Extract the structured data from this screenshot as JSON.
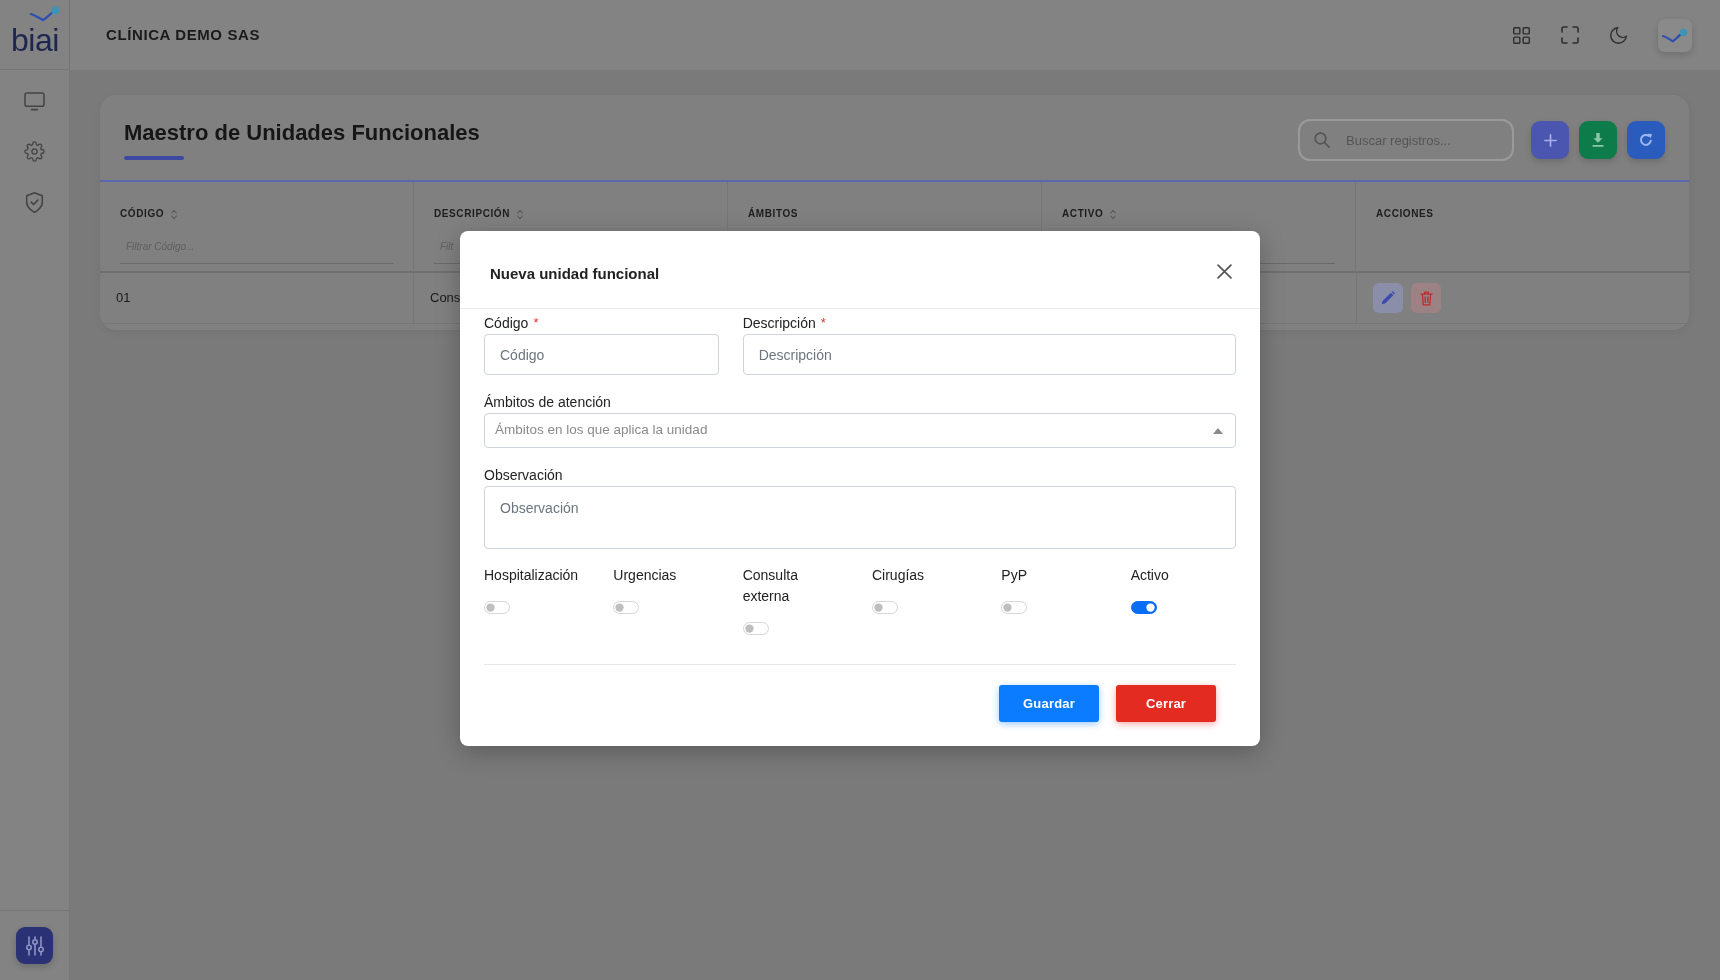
{
  "sidebar": {
    "logo": "biai"
  },
  "topbar": {
    "title": "CLÍNICA DEMO SAS"
  },
  "page": {
    "title": "Maestro de Unidades Funcionales",
    "search": {
      "placeholder": "Buscar registros..."
    }
  },
  "table": {
    "columns": [
      {
        "label": "CÓDIGO",
        "sortable": true,
        "filter": true,
        "filter_placeholder": "Filtrar Código..."
      },
      {
        "label": "DESCRIPCIÓN",
        "sortable": true,
        "filter": true,
        "filter_placeholder": "Filt"
      },
      {
        "label": "ÁMBITOS",
        "sortable": false,
        "filter": false
      },
      {
        "label": "ACTIVO",
        "sortable": true,
        "filter": true
      },
      {
        "label": "ACCIONES",
        "sortable": false,
        "filter": false
      }
    ],
    "rows": [
      {
        "cells": [
          "01",
          "Cons"
        ]
      }
    ]
  },
  "modal": {
    "title": "Nueva unidad funcional",
    "fields": [
      {
        "kind": "input",
        "label": "Código",
        "required_mark": "*",
        "placeholder": "Código"
      },
      {
        "kind": "input",
        "label": "Descripción",
        "required_mark": "*",
        "placeholder": "Descripción"
      },
      {
        "kind": "select",
        "label": "Ámbitos de atención",
        "placeholder": "Ámbitos en los que aplica la unidad"
      },
      {
        "kind": "textarea",
        "label": "Observación",
        "placeholder": "Observación"
      }
    ],
    "toggles": [
      {
        "label": "Hospitalización",
        "on": false
      },
      {
        "label": "Urgencias",
        "on": false
      },
      {
        "label": "Consulta externa",
        "on": false
      },
      {
        "label": "Cirugías",
        "on": false
      },
      {
        "label": "PyP",
        "on": false
      },
      {
        "label": "Activo",
        "on": true
      }
    ],
    "buttons": [
      {
        "label": "Guardar",
        "kind": "primary"
      },
      {
        "label": "Cerrar",
        "kind": "danger"
      }
    ]
  }
}
